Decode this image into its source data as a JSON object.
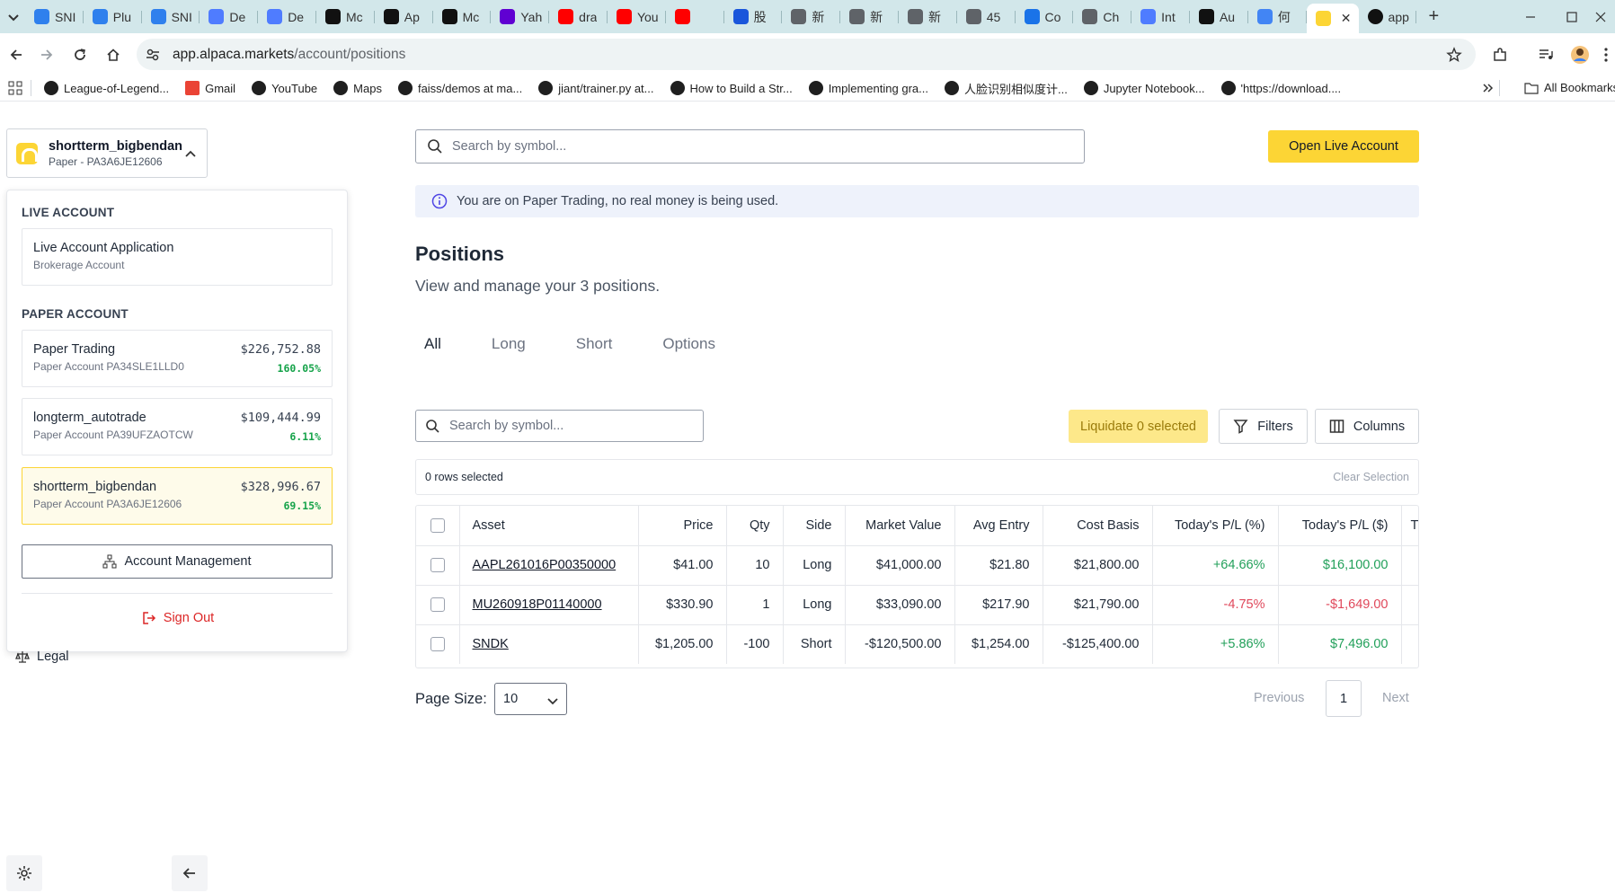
{
  "browser": {
    "tabs": [
      {
        "title": "SNI",
        "icon_color": "#2f80ed"
      },
      {
        "title": "Plu",
        "icon_color": "#2f80ed"
      },
      {
        "title": "SNI",
        "icon_color": "#2f80ed"
      },
      {
        "title": "De",
        "icon_color": "#4f7cff"
      },
      {
        "title": "De",
        "icon_color": "#4f7cff"
      },
      {
        "title": "Mc",
        "icon_color": "#111111"
      },
      {
        "title": "Ap",
        "icon_color": "#111111"
      },
      {
        "title": "Mc",
        "icon_color": "#111111"
      },
      {
        "title": "Yah",
        "icon_color": "#6001d2"
      },
      {
        "title": "dra",
        "icon_color": "#ff0000"
      },
      {
        "title": "You",
        "icon_color": "#ff0000"
      },
      {
        "title": "",
        "icon_color": "#ff0000"
      },
      {
        "title": "股",
        "icon_color": "#1a56db"
      },
      {
        "title": "新",
        "icon_color": "#5f6368"
      },
      {
        "title": "新",
        "icon_color": "#5f6368"
      },
      {
        "title": "新",
        "icon_color": "#5f6368"
      },
      {
        "title": "45",
        "icon_color": "#5f6368"
      },
      {
        "title": "Co",
        "icon_color": "#1a73e8"
      },
      {
        "title": "Ch",
        "icon_color": "#5f6368"
      },
      {
        "title": "Int",
        "icon_color": "#4f7cff"
      },
      {
        "title": "Au",
        "icon_color": "#111111"
      },
      {
        "title": "何",
        "icon_color": "#4285f4"
      }
    ],
    "active_tab": {
      "icon_color": "#fcd535"
    },
    "last_tab": {
      "title": "app",
      "icon_color": "#111111"
    },
    "url_domain": "app.alpaca.markets",
    "url_path": "/account/positions",
    "bookmarks": [
      "League-of-Legend...",
      "Gmail",
      "YouTube",
      "Maps",
      "faiss/demos at ma...",
      "jiant/trainer.py at...",
      "How to Build a Str...",
      "Implementing gra...",
      "人脸识别相似度计...",
      "Jupyter Notebook...",
      "'https://download...."
    ],
    "all_bookmarks": "All Bookmarks"
  },
  "account_switch": {
    "name": "shortterm_bigbendan",
    "id": "Paper - PA3A6JE12606"
  },
  "dropdown": {
    "live_header": "LIVE ACCOUNT",
    "live_card": {
      "name": "Live Account Application",
      "sub": "Brokerage Account"
    },
    "paper_header": "PAPER ACCOUNT",
    "paper_accounts": [
      {
        "name": "Paper Trading",
        "sub": "Paper Account PA34SLE1LLD0",
        "balance": "$226,752.88",
        "pct": "160.05%"
      },
      {
        "name": "longterm_autotrade",
        "sub": "Paper Account PA39UFZAOTCW",
        "balance": "$109,444.99",
        "pct": "6.11%"
      },
      {
        "name": "shortterm_bigbendan",
        "sub": "Paper Account PA3A6JE12606",
        "balance": "$328,996.67",
        "pct": "69.15%"
      }
    ],
    "management": "Account Management",
    "signout": "Sign Out"
  },
  "sidebar": {
    "legal": "Legal"
  },
  "header": {
    "search_placeholder": "Search by symbol...",
    "open_live": "Open Live Account"
  },
  "banner": "You are on Paper Trading, no real money is being used.",
  "page": {
    "title": "Positions",
    "subtitle": "View and manage your 3 positions.",
    "tabs": [
      "All",
      "Long",
      "Short",
      "Options"
    ]
  },
  "table_controls": {
    "search_placeholder": "Search by symbol...",
    "liquidate": "Liquidate 0 selected",
    "filters": "Filters",
    "columns": "Columns",
    "rows_selected": "0 rows selected",
    "clear_selection": "Clear Selection"
  },
  "positions": {
    "headers": [
      "Asset",
      "Price",
      "Qty",
      "Side",
      "Market Value",
      "Avg Entry",
      "Cost Basis",
      "Today's P/L (%)",
      "Today's P/L ($)",
      "T"
    ],
    "rows": [
      {
        "asset": "AAPL261016P00350000",
        "price": "$41.00",
        "qty": "10",
        "side": "Long",
        "market_value": "$41,000.00",
        "avg_entry": "$21.80",
        "cost_basis": "$21,800.00",
        "pl_pct": "+64.66%",
        "pl_usd": "$16,100.00",
        "trend": "pos"
      },
      {
        "asset": "MU260918P01140000",
        "price": "$330.90",
        "qty": "1",
        "side": "Long",
        "market_value": "$33,090.00",
        "avg_entry": "$217.90",
        "cost_basis": "$21,790.00",
        "pl_pct": "-4.75%",
        "pl_usd": "-$1,649.00",
        "trend": "neg"
      },
      {
        "asset": "SNDK",
        "price": "$1,205.00",
        "qty": "-100",
        "side": "Short",
        "market_value": "-$120,500.00",
        "avg_entry": "$1,254.00",
        "cost_basis": "-$125,400.00",
        "pl_pct": "+5.86%",
        "pl_usd": "$7,496.00",
        "trend": "pos"
      }
    ]
  },
  "pagination": {
    "page_size_label": "Page Size:",
    "page_size": "10",
    "previous": "Previous",
    "current": "1",
    "next": "Next"
  },
  "colors": {
    "brand_yellow": "#fcd535",
    "positive": "#22a05a",
    "negative": "#e0485b",
    "signout": "#dc2626"
  }
}
